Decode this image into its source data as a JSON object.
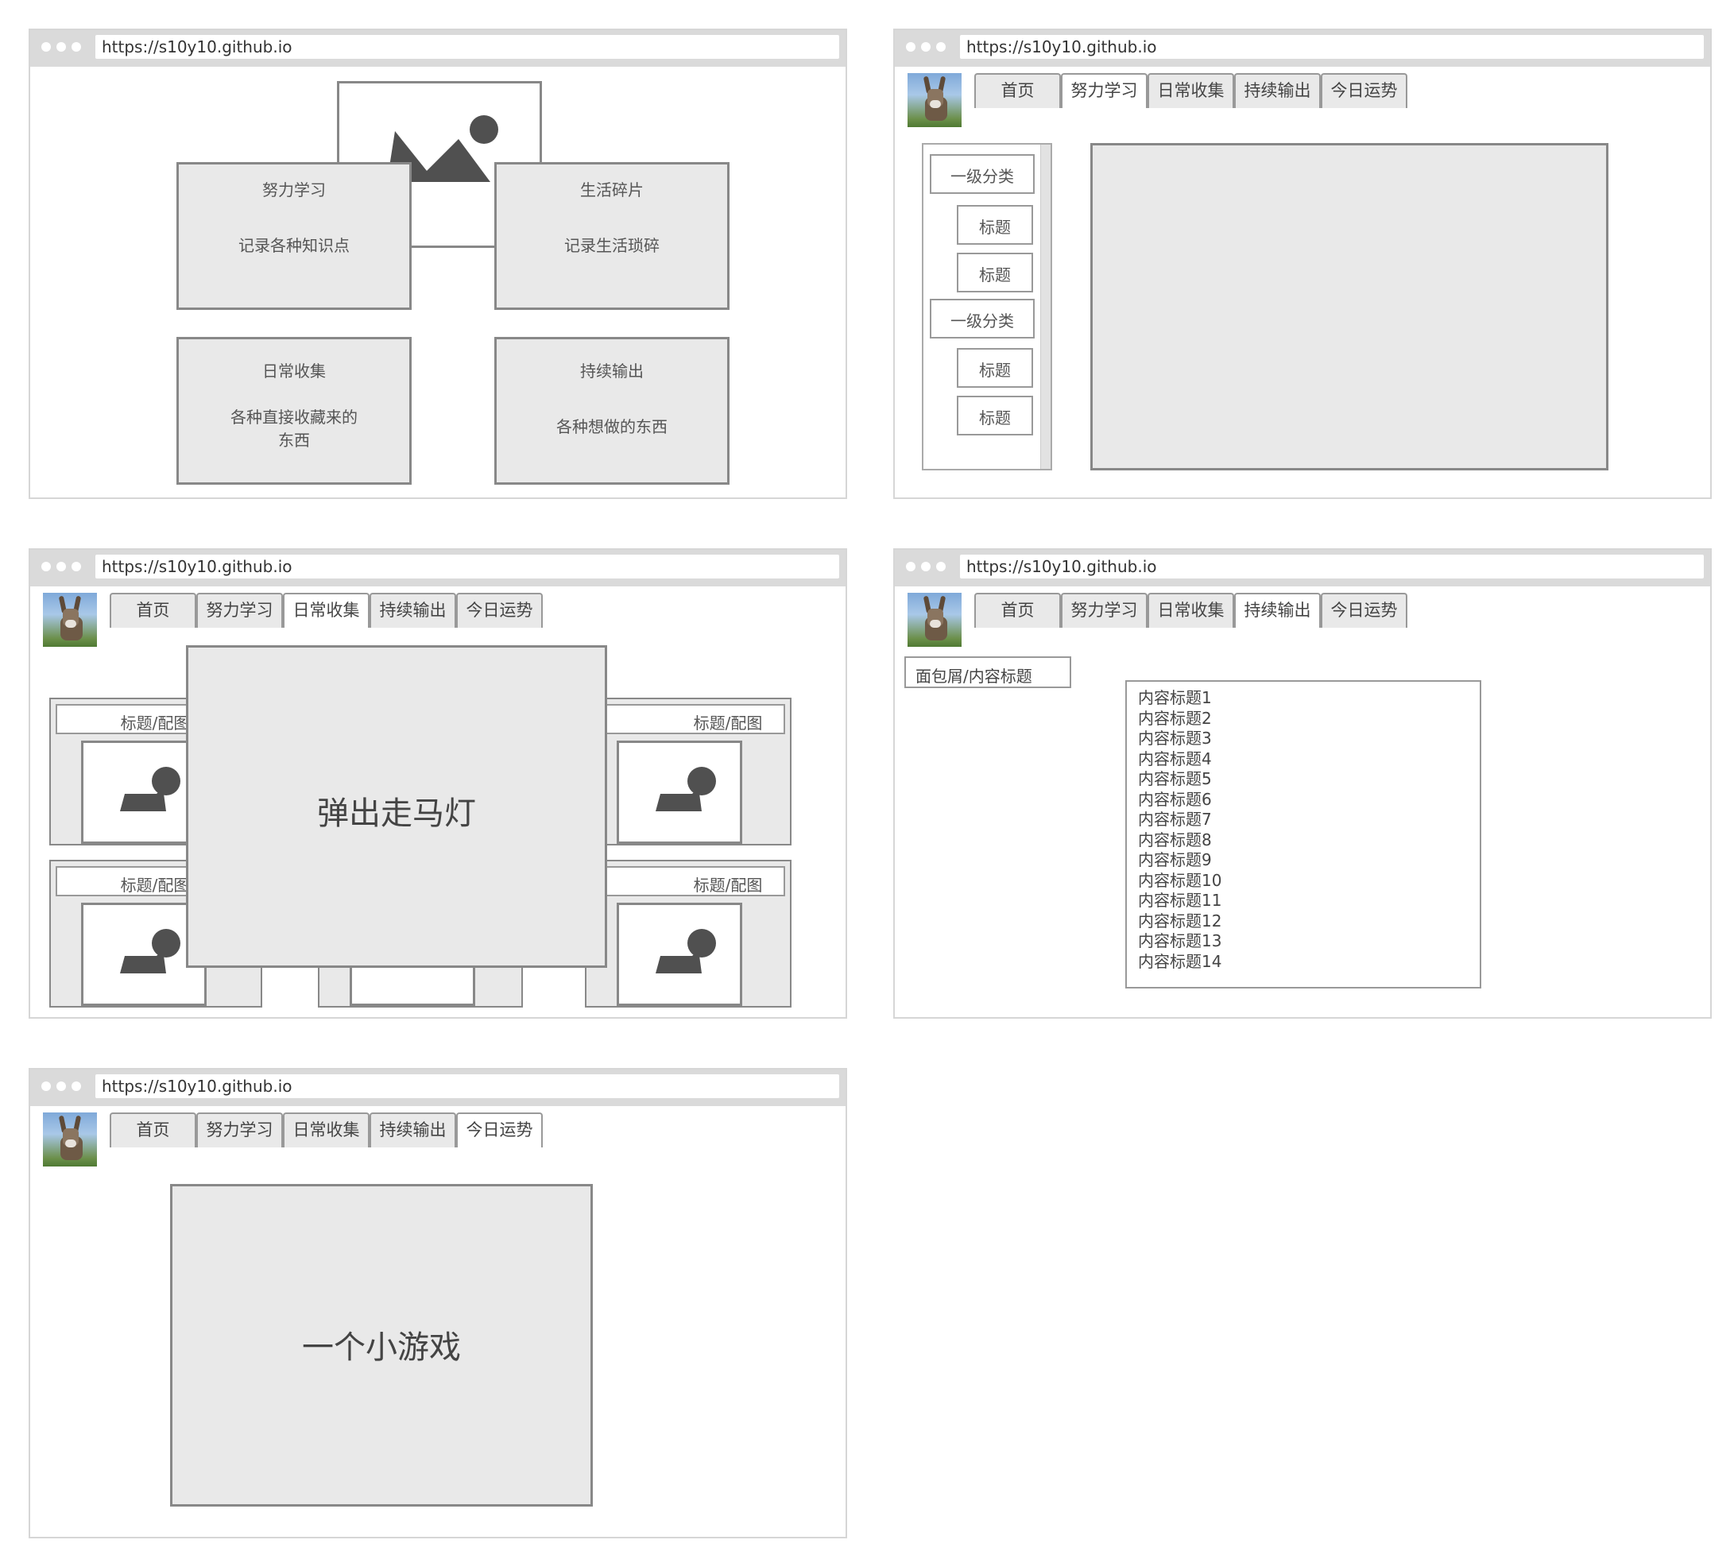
{
  "url": "https://s10y10.github.io",
  "nav": [
    "首页",
    "努力学习",
    "日常收集",
    "持续输出",
    "今日运势"
  ],
  "panel1": {
    "cards": [
      {
        "title": "努力学习",
        "desc": "记录各种知识点"
      },
      {
        "title": "生活碎片",
        "desc": "记录生活琐碎"
      },
      {
        "title": "日常收集",
        "desc": "各种直接收藏来的东西"
      },
      {
        "title": "持续输出",
        "desc": "各种想做的东西"
      }
    ]
  },
  "panel2": {
    "sidebar": [
      {
        "type": "category",
        "label": "一级分类"
      },
      {
        "type": "item",
        "label": "标题"
      },
      {
        "type": "item",
        "label": "标题"
      },
      {
        "type": "category",
        "label": "一级分类"
      },
      {
        "type": "item",
        "label": "标题"
      },
      {
        "type": "item",
        "label": "标题"
      }
    ]
  },
  "panel3": {
    "card_label": "标题/配图",
    "popup_text": "弹出走马灯"
  },
  "panel4": {
    "breadcrumb": "面包屑/内容标题",
    "items": [
      "内容标题1",
      "内容标题2",
      "内容标题3",
      "内容标题4",
      "内容标题5",
      "内容标题6",
      "内容标题7",
      "内容标题8",
      "内容标题9",
      "内容标题10",
      "内容标题11",
      "内容标题12",
      "内容标题13",
      "内容标题14"
    ]
  },
  "panel5": {
    "game_text": "一个小游戏"
  },
  "colors": {
    "box_fill": "#e9e9e9",
    "box_border": "#888888",
    "chrome": "#dadada",
    "icon_fill": "#505050"
  }
}
